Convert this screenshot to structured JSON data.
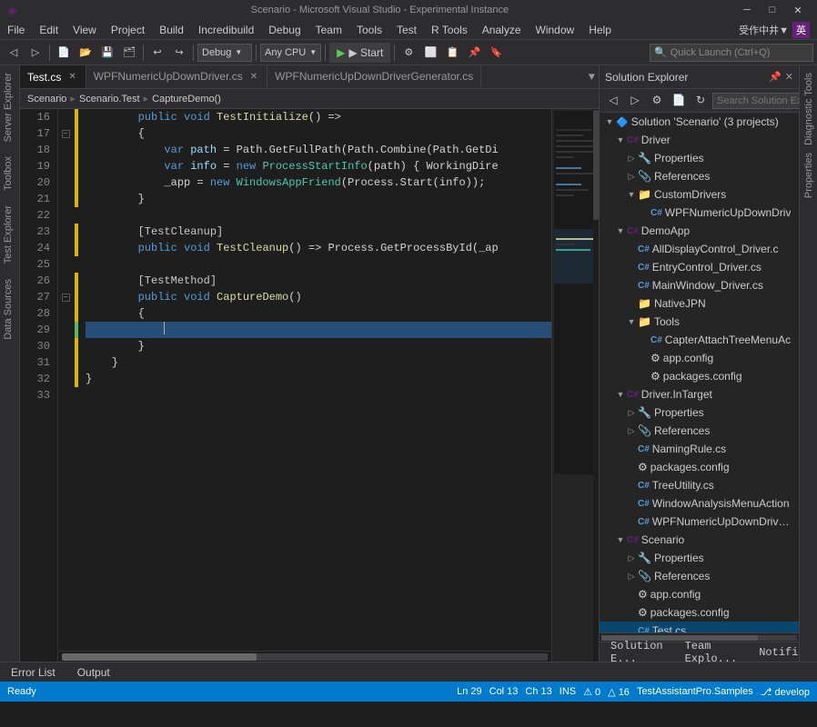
{
  "titleBar": {
    "title": "Scenario - Microsoft Visual Studio - Experimental Instance",
    "vsIcon": "◈",
    "minimize": "─",
    "maximize": "□",
    "close": "✕"
  },
  "menuBar": {
    "items": [
      "File",
      "Edit",
      "View",
      "Project",
      "Build",
      "Incredibuild",
      "Debug",
      "Team",
      "Tools",
      "Test",
      "R Tools",
      "Analyze",
      "Window",
      "Help"
    ]
  },
  "toolbar": {
    "debugMode": "Debug",
    "platform": "Any CPU",
    "startLabel": "▶ Start",
    "searchPlaceholder": "Quick Launch (Ctrl+Q)"
  },
  "tabs": {
    "items": [
      {
        "label": "Test.cs",
        "active": true,
        "modified": false
      },
      {
        "label": "WPFNumericUpDownDriver.cs",
        "active": false
      },
      {
        "label": "WPFNumericUpDownDriverGenerator.cs",
        "active": false
      }
    ]
  },
  "breadcrumb": {
    "parts": [
      "Scenario",
      "Scenario.Test",
      "CaptureDemo()"
    ]
  },
  "codeLines": [
    {
      "num": 16,
      "indent": 2,
      "tokens": [
        {
          "t": "        public ",
          "c": "kw"
        },
        {
          "t": "void ",
          "c": "kw"
        },
        {
          "t": "TestInitialize()",
          "c": "method"
        }
      ]
    },
    {
      "num": 17,
      "indent": 2,
      "tokens": [
        {
          "t": "        {",
          "c": ""
        }
      ]
    },
    {
      "num": 18,
      "indent": 3,
      "tokens": [
        {
          "t": "            var ",
          "c": "kw"
        },
        {
          "t": "path = Path.GetFullPath(Path.Combine(Path.GetDi",
          "c": ""
        }
      ]
    },
    {
      "num": 19,
      "indent": 3,
      "tokens": [
        {
          "t": "            var ",
          "c": "kw"
        },
        {
          "t": "info = new ProcessStartInfo(path) { WorkingDire",
          "c": ""
        }
      ]
    },
    {
      "num": 20,
      "indent": 3,
      "tokens": [
        {
          "t": "            _app = new WindowsAppFriend(Process.Start(info));",
          "c": ""
        }
      ]
    },
    {
      "num": 21,
      "indent": 2,
      "tokens": [
        {
          "t": "        }",
          "c": ""
        }
      ]
    },
    {
      "num": 22,
      "indent": 2,
      "tokens": [
        {
          "t": "",
          "c": ""
        }
      ]
    },
    {
      "num": 23,
      "indent": 2,
      "tokens": [
        {
          "t": "        [TestCleanup]",
          "c": "attr"
        }
      ]
    },
    {
      "num": 24,
      "indent": 2,
      "tokens": [
        {
          "t": "        public ",
          "c": "kw"
        },
        {
          "t": "void ",
          "c": "kw"
        },
        {
          "t": "TestCleanup() => Process.GetProcessById(_ap",
          "c": ""
        }
      ]
    },
    {
      "num": 25,
      "indent": 2,
      "tokens": [
        {
          "t": "",
          "c": ""
        }
      ]
    },
    {
      "num": 26,
      "indent": 2,
      "tokens": [
        {
          "t": "        [TestMethod]",
          "c": "attr"
        }
      ]
    },
    {
      "num": 27,
      "indent": 2,
      "tokens": [
        {
          "t": "        public ",
          "c": "kw"
        },
        {
          "t": "void ",
          "c": "kw"
        },
        {
          "t": "CaptureDemo()",
          "c": "method"
        }
      ],
      "highlight": false
    },
    {
      "num": 28,
      "indent": 2,
      "tokens": [
        {
          "t": "        {",
          "c": ""
        }
      ]
    },
    {
      "num": 29,
      "indent": 2,
      "tokens": [
        {
          "t": "            ",
          "c": ""
        }
      ],
      "highlight": true
    },
    {
      "num": 30,
      "indent": 2,
      "tokens": [
        {
          "t": "        }",
          "c": ""
        }
      ]
    },
    {
      "num": 31,
      "indent": 2,
      "tokens": [
        {
          "t": "    }",
          "c": ""
        }
      ]
    },
    {
      "num": 32,
      "indent": 1,
      "tokens": [
        {
          "t": "}",
          "c": ""
        }
      ]
    },
    {
      "num": 33,
      "indent": 0,
      "tokens": [
        {
          "t": "",
          "c": ""
        }
      ]
    }
  ],
  "solutionExplorer": {
    "title": "Solution Explorer",
    "searchPlaceholder": "Search Solution Explorer (Ctrl+;)",
    "tree": [
      {
        "level": 0,
        "label": "Solution 'Scenario' (3 projects)",
        "icon": "🔷",
        "expand": "▼",
        "isExpanded": true
      },
      {
        "level": 1,
        "label": "Driver",
        "icon": "C#",
        "expand": "▼",
        "isExpanded": true,
        "iconColor": "#68217a"
      },
      {
        "level": 2,
        "label": "Properties",
        "icon": "🔧",
        "expand": "▷"
      },
      {
        "level": 2,
        "label": "References",
        "icon": "📎",
        "expand": "▷"
      },
      {
        "level": 2,
        "label": "CustomDrivers",
        "icon": "📁",
        "expand": "▼",
        "isExpanded": true
      },
      {
        "level": 3,
        "label": "WPFNumericUpDownDriv",
        "icon": "C#",
        "iconColor": "#569cd6"
      },
      {
        "level": 1,
        "label": "DemoApp",
        "icon": "C#",
        "expand": "▼",
        "isExpanded": true,
        "iconColor": "#68217a"
      },
      {
        "level": 2,
        "label": "AllDisplayControl_Driver.c",
        "icon": "C#",
        "iconColor": "#569cd6"
      },
      {
        "level": 2,
        "label": "EntryControl_Driver.cs",
        "icon": "C#",
        "iconColor": "#569cd6"
      },
      {
        "level": 2,
        "label": "MainWindow_Driver.cs",
        "icon": "C#",
        "iconColor": "#569cd6"
      },
      {
        "level": 2,
        "label": "NativeJPN",
        "icon": "📁"
      },
      {
        "level": 2,
        "label": "Tools",
        "icon": "📁",
        "expand": "▼",
        "isExpanded": true
      },
      {
        "level": 3,
        "label": "CapterAttachTreeMenuAc",
        "icon": "C#",
        "iconColor": "#569cd6"
      },
      {
        "level": 3,
        "label": "app.config",
        "icon": "⚙",
        "iconColor": "#ccc"
      },
      {
        "level": 3,
        "label": "packages.config",
        "icon": "⚙",
        "iconColor": "#ccc"
      },
      {
        "level": 1,
        "label": "Driver.InTarget",
        "icon": "C#",
        "expand": "▼",
        "isExpanded": true,
        "iconColor": "#68217a"
      },
      {
        "level": 2,
        "label": "Properties",
        "icon": "🔧",
        "expand": "▷"
      },
      {
        "level": 2,
        "label": "References",
        "icon": "📎",
        "expand": "▷"
      },
      {
        "level": 2,
        "label": "NamingRule.cs",
        "icon": "C#",
        "iconColor": "#569cd6"
      },
      {
        "level": 2,
        "label": "packages.config",
        "icon": "⚙",
        "iconColor": "#ccc"
      },
      {
        "level": 2,
        "label": "TreeUtility.cs",
        "icon": "C#",
        "iconColor": "#569cd6"
      },
      {
        "level": 2,
        "label": "WindowAnalysisMenuAction",
        "icon": "C#",
        "iconColor": "#569cd6"
      },
      {
        "level": 2,
        "label": "WPFNumericUpDownDriverC",
        "icon": "C#",
        "iconColor": "#569cd6"
      },
      {
        "level": 1,
        "label": "Scenario",
        "icon": "C#",
        "expand": "▼",
        "isExpanded": true,
        "iconColor": "#68217a"
      },
      {
        "level": 2,
        "label": "Properties",
        "icon": "🔧",
        "expand": "▷"
      },
      {
        "level": 2,
        "label": "References",
        "icon": "📎",
        "expand": "▷"
      },
      {
        "level": 2,
        "label": "app.config",
        "icon": "⚙",
        "iconColor": "#ccc"
      },
      {
        "level": 2,
        "label": "packages.config",
        "icon": "⚙",
        "iconColor": "#ccc"
      },
      {
        "level": 2,
        "label": "Test.cs",
        "icon": "C#",
        "iconColor": "#569cd6"
      }
    ]
  },
  "solBottomTabs": [
    "Solution E...",
    "Team Explo...",
    "Notificati..."
  ],
  "bottomTabs": [
    "Error List",
    "Output"
  ],
  "statusBar": {
    "ready": "Ready",
    "ln": "Ln 29",
    "col": "Col 13",
    "ch": "Ch 13",
    "ins": "INS",
    "err": "⚠ 0",
    "warn": "△ 16",
    "project": "TestAssistantPro.Samples",
    "branch": "develop"
  },
  "sidebar": {
    "leftItems": [
      "Server Explorer",
      "Toolbox",
      "Test Explorer",
      "Data Sources"
    ],
    "rightItems": [
      "Diagnostic Tools",
      "Properties"
    ]
  }
}
